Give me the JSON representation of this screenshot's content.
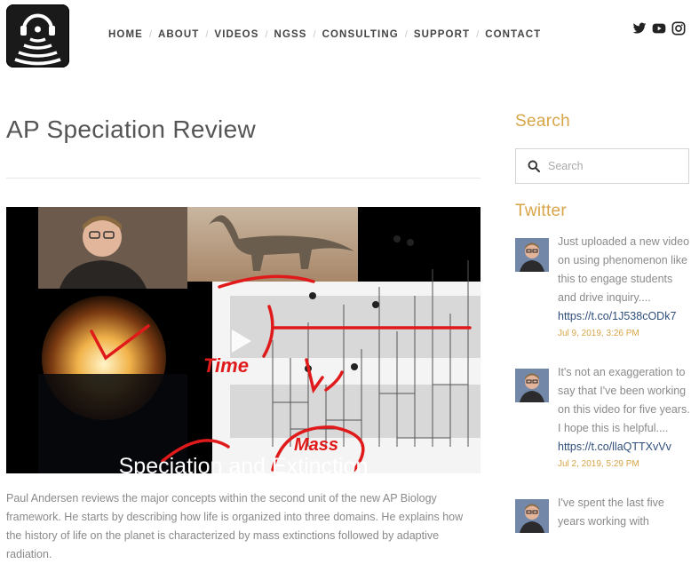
{
  "nav": {
    "items": [
      "HOME",
      "ABOUT",
      "VIDEOS",
      "NGSS",
      "CONSULTING",
      "SUPPORT",
      "CONTACT"
    ]
  },
  "social": [
    "twitter-icon",
    "youtube-icon",
    "instagram-icon"
  ],
  "post": {
    "title": "AP Speciation Review",
    "video_caption": "Speciation and Extinction",
    "video_annotations": [
      "Time",
      "Mass"
    ],
    "description": "Paul Andersen reviews the major concepts within the second unit of the new AP Biology framework. He starts by describing how life is organized into three domains. He explains how the history of life on the planet is characterized by mass extinctions followed by adaptive radiation."
  },
  "sidebar": {
    "search_heading": "Search",
    "search_placeholder": "Search",
    "twitter_heading": "Twitter",
    "tweets": [
      {
        "text": "Just uploaded a new video on using phenomenon like this to engage students and drive inquiry....",
        "link": "https://t.co/1J538cODk7",
        "date": "Jul 9, 2019, 3:26 PM"
      },
      {
        "text": "It's not an exaggeration to say that I've been working on this video for five years. I hope this is helpful....",
        "link": "https://t.co/llaQTTXvVv",
        "date": "Jul 2, 2019, 5:29 PM"
      },
      {
        "text": "I've spent the last five years working with",
        "link": "",
        "date": ""
      }
    ]
  },
  "colors": {
    "accent": "#d8a548",
    "link": "#2f4e7a",
    "text": "#555555",
    "muted": "#8a8a8a"
  }
}
